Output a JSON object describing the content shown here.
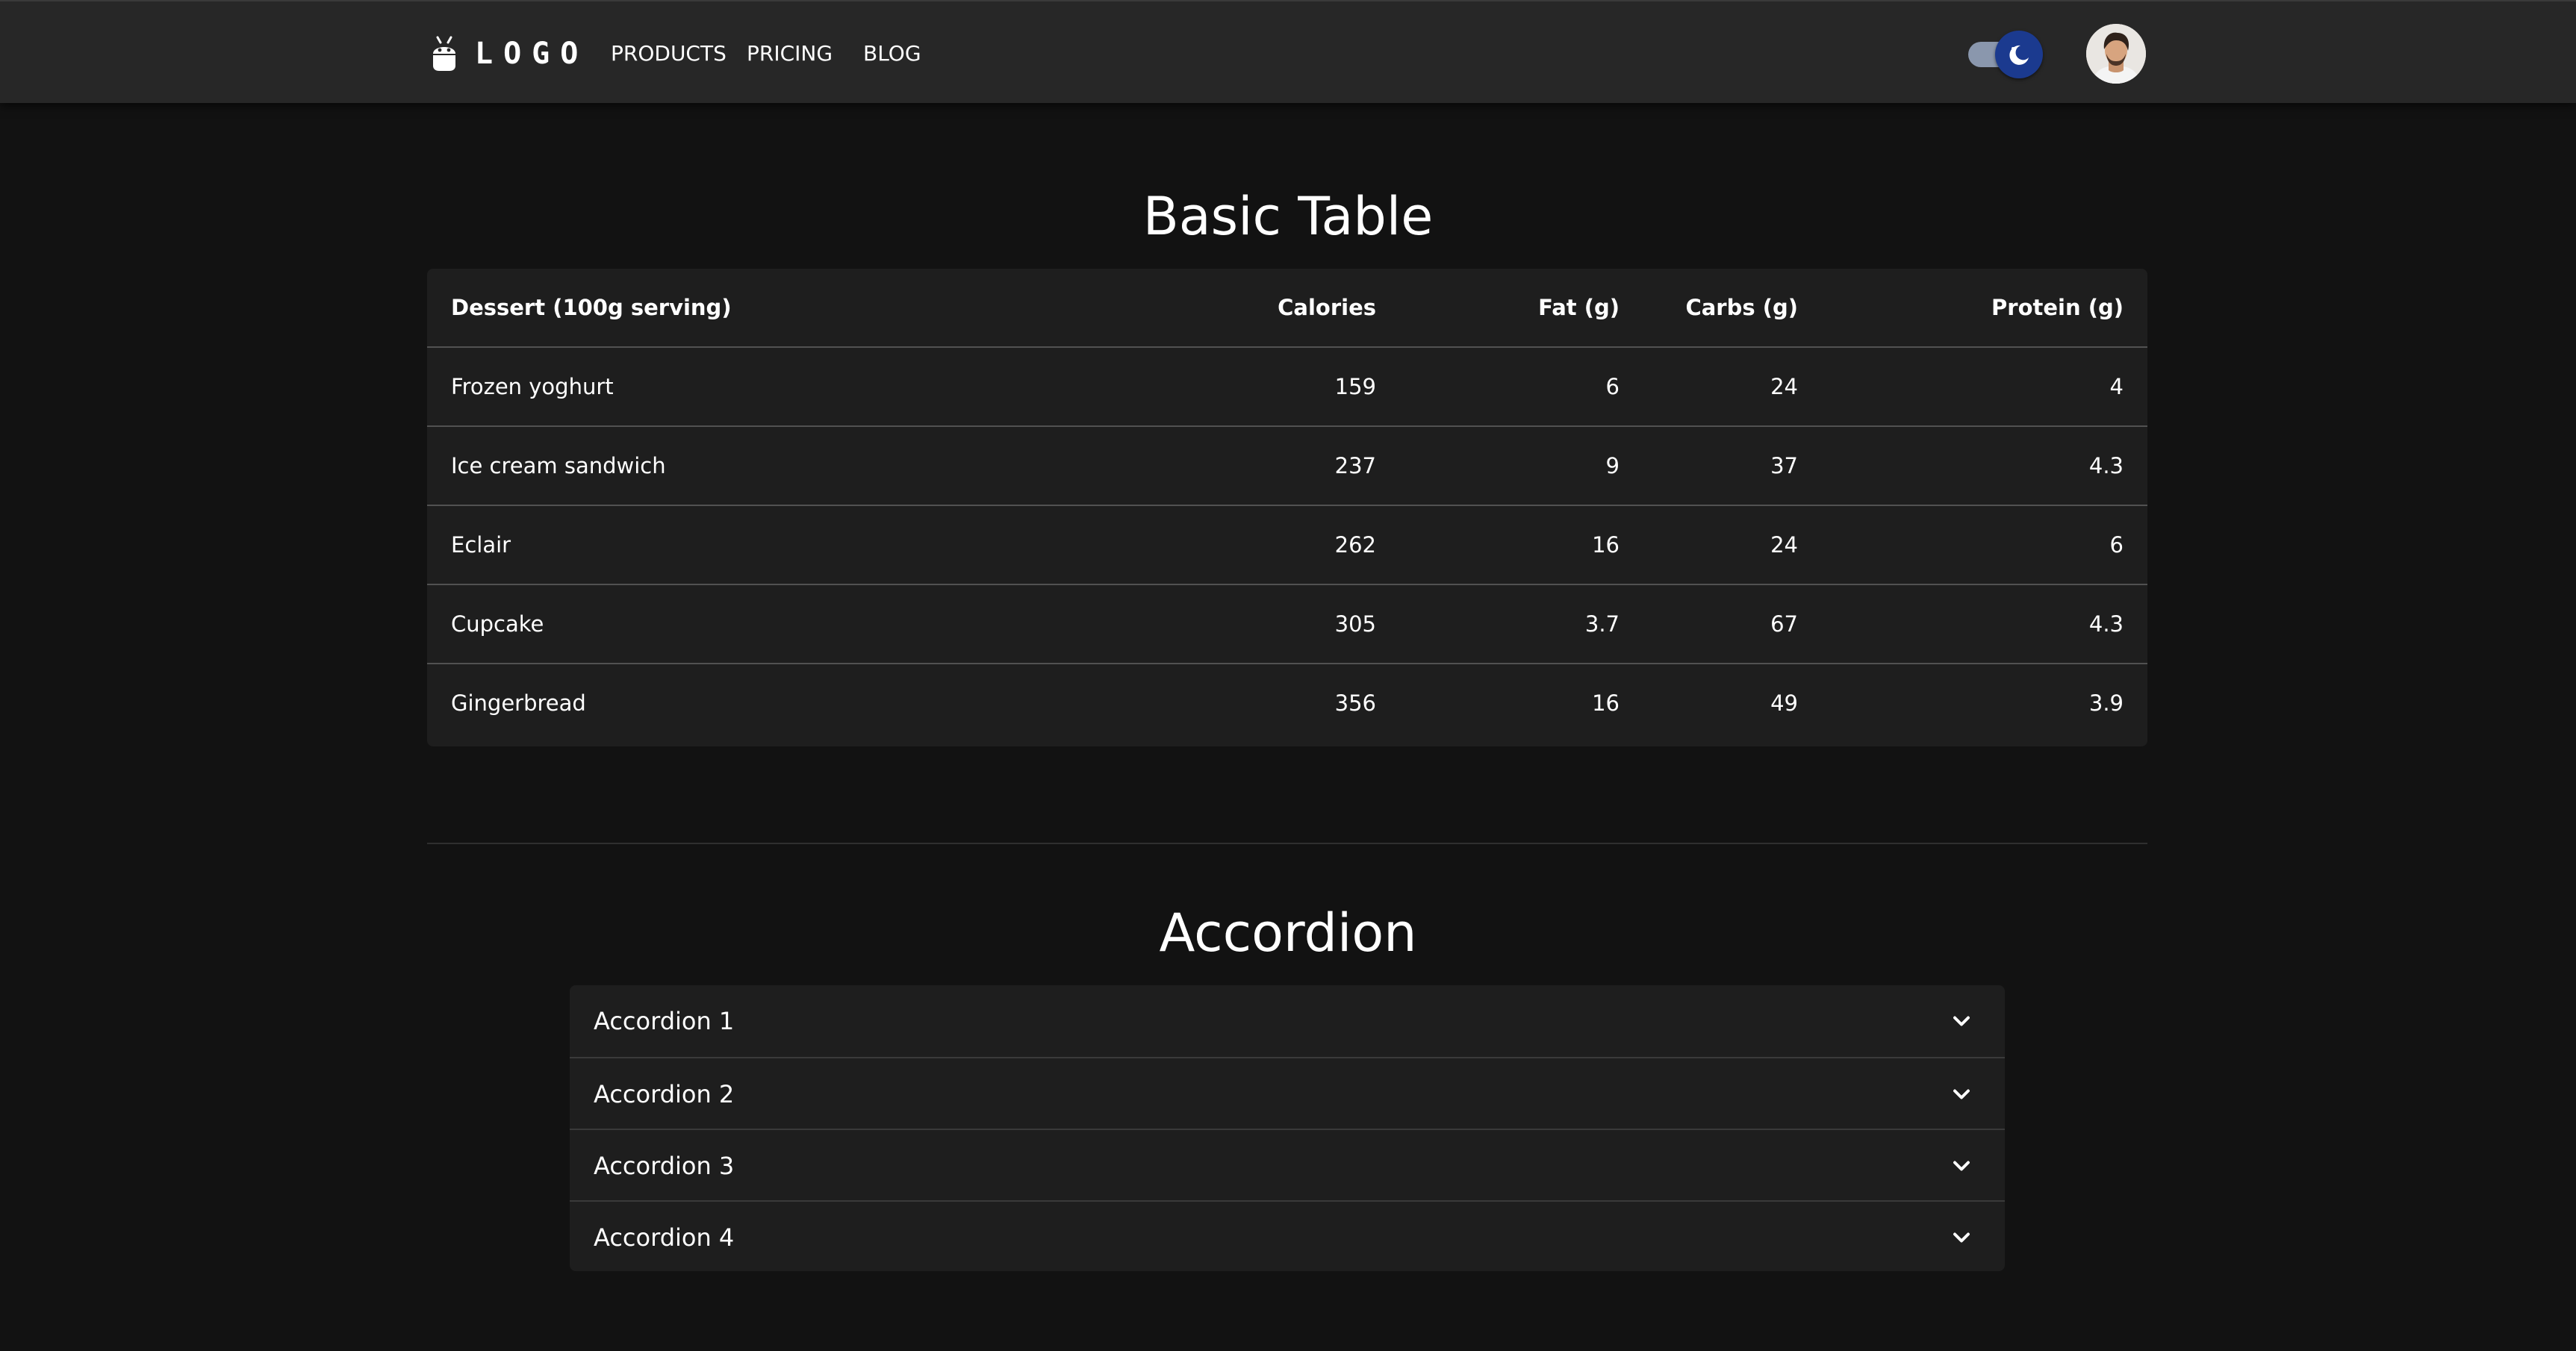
{
  "header": {
    "logo_text": "LOGO",
    "logo_icon": "android-icon",
    "nav": [
      {
        "label": "PRODUCTS"
      },
      {
        "label": "PRICING"
      },
      {
        "label": "BLOG"
      }
    ],
    "theme_toggle": {
      "icon": "dark-mode-moon-icon",
      "state": "dark"
    },
    "avatar_icon": "user-avatar"
  },
  "table_section": {
    "title": "Basic Table",
    "columns": [
      "Dessert (100g serving)",
      "Calories",
      "Fat (g)",
      "Carbs (g)",
      "Protein (g)"
    ],
    "rows": [
      [
        "Frozen yoghurt",
        "159",
        "6",
        "24",
        "4"
      ],
      [
        "Ice cream sandwich",
        "237",
        "9",
        "37",
        "4.3"
      ],
      [
        "Eclair",
        "262",
        "16",
        "24",
        "6"
      ],
      [
        "Cupcake",
        "305",
        "3.7",
        "67",
        "4.3"
      ],
      [
        "Gingerbread",
        "356",
        "16",
        "49",
        "3.9"
      ]
    ]
  },
  "accordion_section": {
    "title": "Accordion",
    "items": [
      {
        "label": "Accordion 1",
        "icon": "chevron-down-icon"
      },
      {
        "label": "Accordion 2",
        "icon": "chevron-down-icon"
      },
      {
        "label": "Accordion 3",
        "icon": "chevron-down-icon"
      },
      {
        "label": "Accordion 4",
        "icon": "chevron-down-icon"
      }
    ]
  },
  "colors": {
    "background": "#121212",
    "appbar": "#272727",
    "surface": "#1e1e1e",
    "toggle_thumb": "#1b3a8f",
    "toggle_track": "#8a97ad"
  }
}
